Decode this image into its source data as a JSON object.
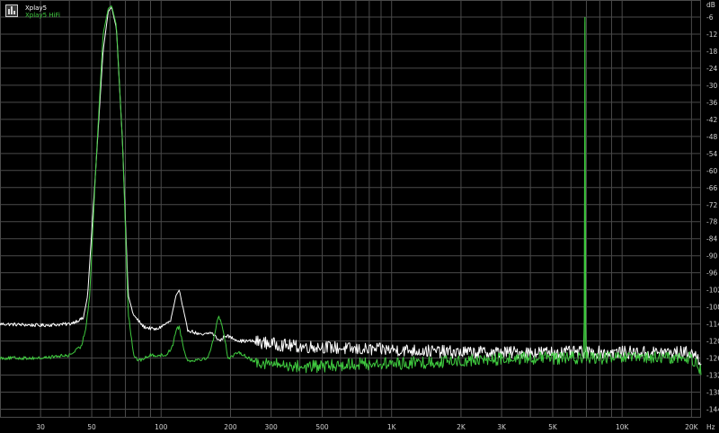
{
  "chart_data": {
    "type": "line",
    "x_scale": "log",
    "xlim": [
      20,
      22000
    ],
    "ylim": [
      -147,
      0
    ],
    "grid": true,
    "y_unit": "dB",
    "x_unit": "Hz",
    "y_ticks": [
      -6,
      -12,
      -18,
      -24,
      -30,
      -36,
      -42,
      -48,
      -54,
      -60,
      -66,
      -72,
      -78,
      -84,
      -90,
      -96,
      -102,
      -108,
      -114,
      -120,
      -126,
      -132,
      -138,
      -144
    ],
    "x_tick_labels": [
      {
        "value": 30,
        "label": "30"
      },
      {
        "value": 50,
        "label": "50"
      },
      {
        "value": 100,
        "label": "100"
      },
      {
        "value": 200,
        "label": "200"
      },
      {
        "value": 300,
        "label": "300"
      },
      {
        "value": 500,
        "label": "500"
      },
      {
        "value": 1000,
        "label": "1K"
      },
      {
        "value": 2000,
        "label": "2K"
      },
      {
        "value": 3000,
        "label": "3K"
      },
      {
        "value": 5000,
        "label": "5K"
      },
      {
        "value": 10000,
        "label": "10K"
      },
      {
        "value": 20000,
        "label": "20K"
      }
    ],
    "series": [
      {
        "name": "Xplay5",
        "color": "#ffffff",
        "points": [
          [
            20,
            -114
          ],
          [
            30,
            -114.5
          ],
          [
            40,
            -114
          ],
          [
            46,
            -112
          ],
          [
            48,
            -104
          ],
          [
            52,
            -60
          ],
          [
            56,
            -18
          ],
          [
            59,
            -4
          ],
          [
            61,
            -2.5
          ],
          [
            64,
            -10
          ],
          [
            68,
            -50
          ],
          [
            72,
            -104
          ],
          [
            76,
            -111
          ],
          [
            84,
            -115
          ],
          [
            95,
            -116
          ],
          [
            110,
            -113
          ],
          [
            116,
            -104
          ],
          [
            120,
            -102
          ],
          [
            124,
            -108
          ],
          [
            130,
            -116
          ],
          [
            150,
            -118
          ],
          [
            165,
            -117
          ],
          [
            180,
            -120
          ],
          [
            190,
            -118
          ],
          [
            220,
            -120
          ],
          [
            250,
            -120
          ],
          [
            300,
            -121
          ],
          [
            400,
            -122
          ],
          [
            500,
            -122
          ],
          [
            700,
            -123
          ],
          [
            1000,
            -123
          ],
          [
            2000,
            -124
          ],
          [
            4000,
            -124
          ],
          [
            6000,
            -124
          ],
          [
            6800,
            -124
          ],
          [
            7000,
            -124
          ],
          [
            10000,
            -124
          ],
          [
            15000,
            -124
          ],
          [
            20000,
            -124
          ],
          [
            22000,
            -127
          ]
        ]
      },
      {
        "name": "Xplay5 HiFi",
        "color": "#3fc93f",
        "points": [
          [
            20,
            -126
          ],
          [
            30,
            -126
          ],
          [
            40,
            -125
          ],
          [
            45,
            -122
          ],
          [
            47,
            -116
          ],
          [
            49,
            -104
          ],
          [
            52,
            -60
          ],
          [
            56,
            -12
          ],
          [
            59,
            -3
          ],
          [
            61,
            -2
          ],
          [
            64,
            -9
          ],
          [
            68,
            -50
          ],
          [
            72,
            -110
          ],
          [
            76,
            -125
          ],
          [
            80,
            -127
          ],
          [
            90,
            -125
          ],
          [
            105,
            -125
          ],
          [
            112,
            -122
          ],
          [
            116,
            -116
          ],
          [
            120,
            -115
          ],
          [
            124,
            -121
          ],
          [
            130,
            -127
          ],
          [
            160,
            -126
          ],
          [
            170,
            -118
          ],
          [
            178,
            -111
          ],
          [
            186,
            -116
          ],
          [
            195,
            -126
          ],
          [
            220,
            -124
          ],
          [
            250,
            -127
          ],
          [
            300,
            -128
          ],
          [
            400,
            -129
          ],
          [
            500,
            -129
          ],
          [
            700,
            -128
          ],
          [
            1000,
            -128
          ],
          [
            2000,
            -127
          ],
          [
            4000,
            -126
          ],
          [
            6500,
            -126
          ],
          [
            6800,
            -126
          ],
          [
            6850,
            -112
          ],
          [
            6900,
            -6
          ],
          [
            6950,
            -112
          ],
          [
            7000,
            -126
          ],
          [
            10000,
            -126
          ],
          [
            15000,
            -126
          ],
          [
            20000,
            -126
          ],
          [
            22000,
            -130
          ]
        ]
      }
    ]
  },
  "legend": {
    "items": [
      {
        "label": "Xplay5",
        "color": "#ffffff"
      },
      {
        "label": "Xplay5 HiFi",
        "color": "#3fc93f"
      }
    ]
  },
  "axis": {
    "y_unit_label": "dB",
    "x_unit_label": "Hz"
  },
  "colors": {
    "background": "#000000",
    "grid": "#4a4a4a",
    "tick_text": "#d0d0d0"
  }
}
